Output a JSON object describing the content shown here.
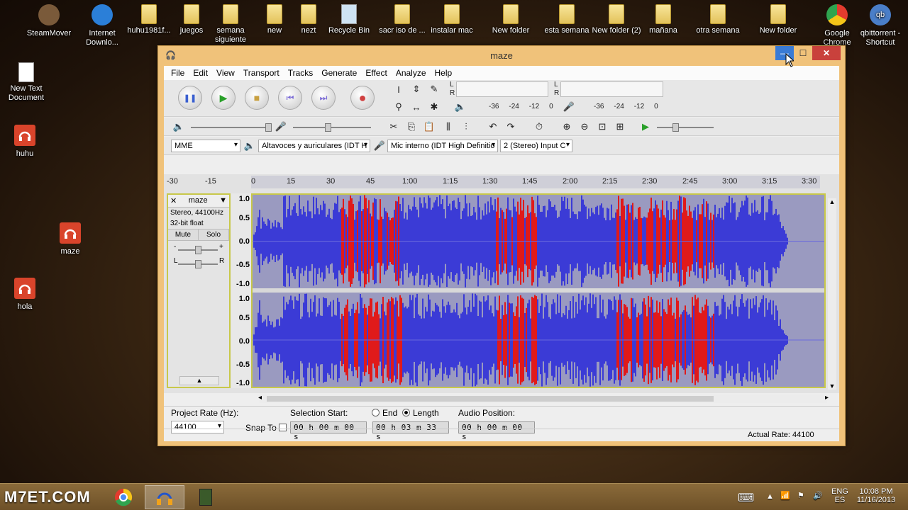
{
  "desktop": {
    "top_icons": [
      {
        "label": "SteamMover",
        "kind": "app"
      },
      {
        "label": "Internet Downlo...",
        "kind": "app"
      },
      {
        "label": "huhu1981f...",
        "kind": "folder"
      },
      {
        "label": "juegos",
        "kind": "folder"
      },
      {
        "label": "semana siguiente",
        "kind": "folder"
      },
      {
        "label": "new",
        "kind": "folder"
      },
      {
        "label": "nezt",
        "kind": "folder"
      },
      {
        "label": "Recycle Bin",
        "kind": "bin"
      },
      {
        "label": "sacr iso de ...",
        "kind": "folder"
      },
      {
        "label": "instalar mac",
        "kind": "folder"
      },
      {
        "label": "New folder",
        "kind": "folder"
      },
      {
        "label": "esta semana",
        "kind": "folder"
      },
      {
        "label": "New folder (2)",
        "kind": "folder"
      },
      {
        "label": "mañana",
        "kind": "folder"
      },
      {
        "label": "otra semana",
        "kind": "folder"
      },
      {
        "label": "New folder",
        "kind": "folder"
      },
      {
        "label": "Google Chrome",
        "kind": "chrome"
      },
      {
        "label": "qbittorrent - Shortcut",
        "kind": "qb"
      }
    ],
    "left_icons": [
      {
        "label": "New Text Document",
        "kind": "doc"
      },
      {
        "label": "huhu",
        "kind": "audacity"
      },
      {
        "label": "hola",
        "kind": "audacity"
      }
    ],
    "middle_icon": {
      "label": "maze",
      "kind": "audacity"
    }
  },
  "window": {
    "title": "maze",
    "min_glyph": "—",
    "max_glyph": "☐",
    "close_glyph": "✕"
  },
  "menu": [
    "File",
    "Edit",
    "View",
    "Transport",
    "Tracks",
    "Generate",
    "Effect",
    "Analyze",
    "Help"
  ],
  "transport": {
    "pause": "❚❚",
    "play": "▶",
    "stop": "■",
    "skip_start": "⏮",
    "skip_end": "⏭",
    "record": "●"
  },
  "meters": {
    "play_scale": [
      "-36",
      "-24",
      "-12",
      "0"
    ],
    "rec_scale": [
      "-36",
      "-24",
      "-12",
      "0"
    ],
    "left": "L",
    "right": "R"
  },
  "devices": {
    "host": "MME",
    "output": "Altavoces y auriculares (IDT H",
    "input": "Mic interno (IDT High Definitio",
    "channels": "2 (Stereo) Input C"
  },
  "ruler": {
    "ticks": [
      "-30",
      "-15",
      "0",
      "15",
      "30",
      "45",
      "1:00",
      "1:15",
      "1:30",
      "1:45",
      "2:00",
      "2:15",
      "2:30",
      "2:45",
      "3:00",
      "3:15",
      "3:30"
    ]
  },
  "track": {
    "name": "maze",
    "format": "Stereo, 44100Hz",
    "bit_depth": "32-bit float",
    "mute": "Mute",
    "solo": "Solo",
    "gain_minus": "-",
    "gain_plus": "+",
    "pan_left": "L",
    "pan_right": "R",
    "y_labels_top": [
      "1.0",
      "0.5",
      "0.0",
      "-0.5",
      "-1.0"
    ],
    "y_labels_bottom": [
      "1.0",
      "0.5",
      "0.0",
      "-0.5",
      "-1.0"
    ],
    "clipped_regions_seconds": [
      [
        35,
        60
      ],
      [
        95,
        112
      ],
      [
        143,
        160
      ],
      [
        160,
        182
      ]
    ]
  },
  "selection": {
    "project_rate_label": "Project Rate (Hz):",
    "project_rate": "44100",
    "snap_to_label": "Snap To",
    "selection_start_label": "Selection Start:",
    "end_label": "End",
    "length_label": "Length",
    "selection_start": "00 h 00 m 00 s",
    "length_value": "00 h 03 m 33 s",
    "audio_position_label": "Audio Position:",
    "audio_position": "00 h 00 m 00 s"
  },
  "status": {
    "actual_rate": "Actual Rate: 44100"
  },
  "taskbar": {
    "language_top": "ENG",
    "language_bottom": "ES",
    "time": "10:08 PM",
    "date": "11/16/2013",
    "watermark": "M7ET.COM"
  },
  "colors": {
    "waveform": "#3b3bd6",
    "clipping": "#e01a1a",
    "wave_bg": "#9a9ac0"
  }
}
